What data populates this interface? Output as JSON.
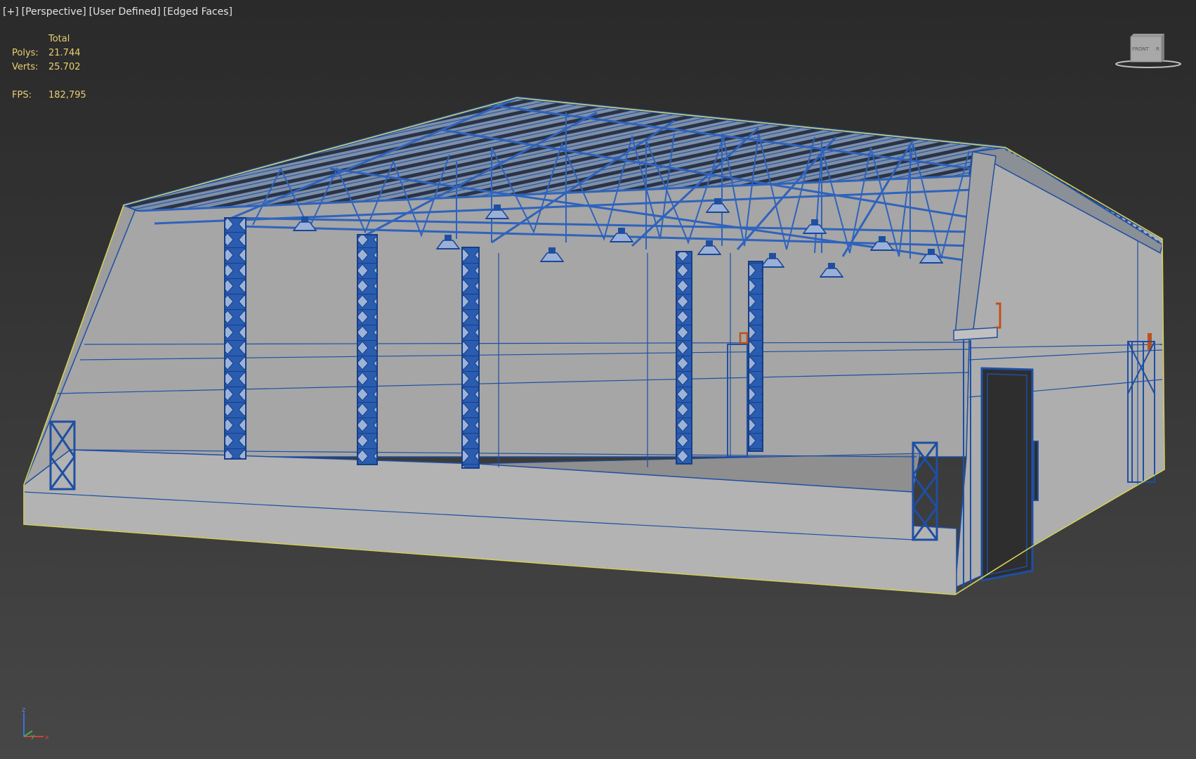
{
  "viewport_label": {
    "plus": "[+]",
    "view": "[Perspective]",
    "shading_preset": "[User Defined]",
    "shading_mode": "[Edged Faces]"
  },
  "stats": {
    "header": "Total",
    "polys_label": "Polys:",
    "polys_value": "21.744",
    "verts_label": "Verts:",
    "verts_value": "25.702",
    "fps_label": "FPS:",
    "fps_value": "182,795"
  },
  "viewcube": {
    "front_label": "FRONT",
    "right_label": "R"
  },
  "axis_tripod": {
    "x": "x",
    "y": "y",
    "z": "z"
  },
  "colors": {
    "viewport_bg": "#333333",
    "wire_blue": "#1e4fa3",
    "face_gray": "#a9a9a9",
    "selection_yellow": "#d8d25a",
    "stats_yellow": "#e8d070",
    "helper_orange": "#c0501a"
  },
  "icons": [
    "viewcube-icon",
    "axis-tripod-icon"
  ]
}
